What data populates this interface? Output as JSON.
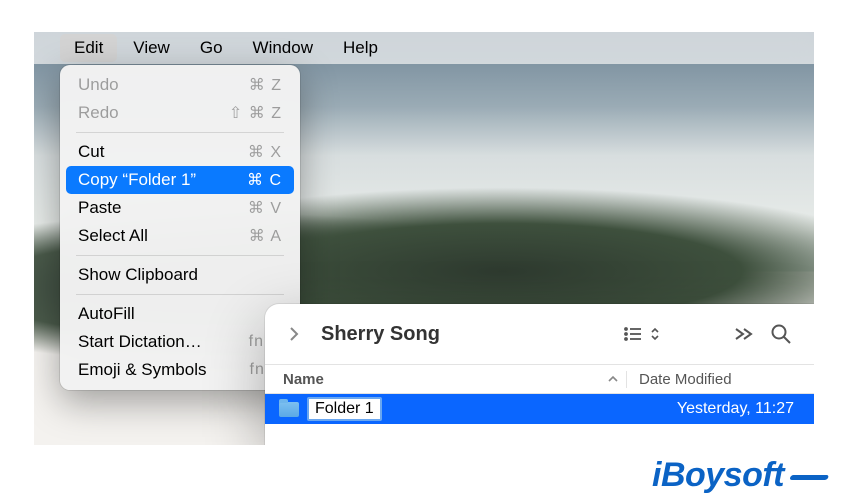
{
  "menubar": {
    "items": [
      "Edit",
      "View",
      "Go",
      "Window",
      "Help"
    ],
    "open_index": 0
  },
  "edit_menu": {
    "undo": {
      "label": "Undo",
      "shortcut": "⌘ Z",
      "disabled": true
    },
    "redo": {
      "label": "Redo",
      "shortcut": "⇧ ⌘ Z",
      "disabled": true
    },
    "cut": {
      "label": "Cut",
      "shortcut": "⌘ X"
    },
    "copy": {
      "label": "Copy “Folder 1”",
      "shortcut": "⌘ C",
      "highlight": true
    },
    "paste": {
      "label": "Paste",
      "shortcut": "⌘ V"
    },
    "select_all": {
      "label": "Select All",
      "shortcut": "⌘ A"
    },
    "show_clipboard": {
      "label": "Show Clipboard",
      "shortcut": ""
    },
    "autofill": {
      "label": "AutoFill",
      "shortcut": "›"
    },
    "start_dictation": {
      "label": "Start Dictation…",
      "shortcut": "fn D"
    },
    "emoji_symbols": {
      "label": "Emoji & Symbols",
      "shortcut": "fn E"
    }
  },
  "finder": {
    "title": "Sherry Song",
    "columns": {
      "name": "Name",
      "date": "Date Modified"
    },
    "rows": [
      {
        "name": "Folder 1",
        "date": "Yesterday, 11:27",
        "selected": true,
        "editing": true
      }
    ]
  },
  "watermark": "iBoysoft"
}
